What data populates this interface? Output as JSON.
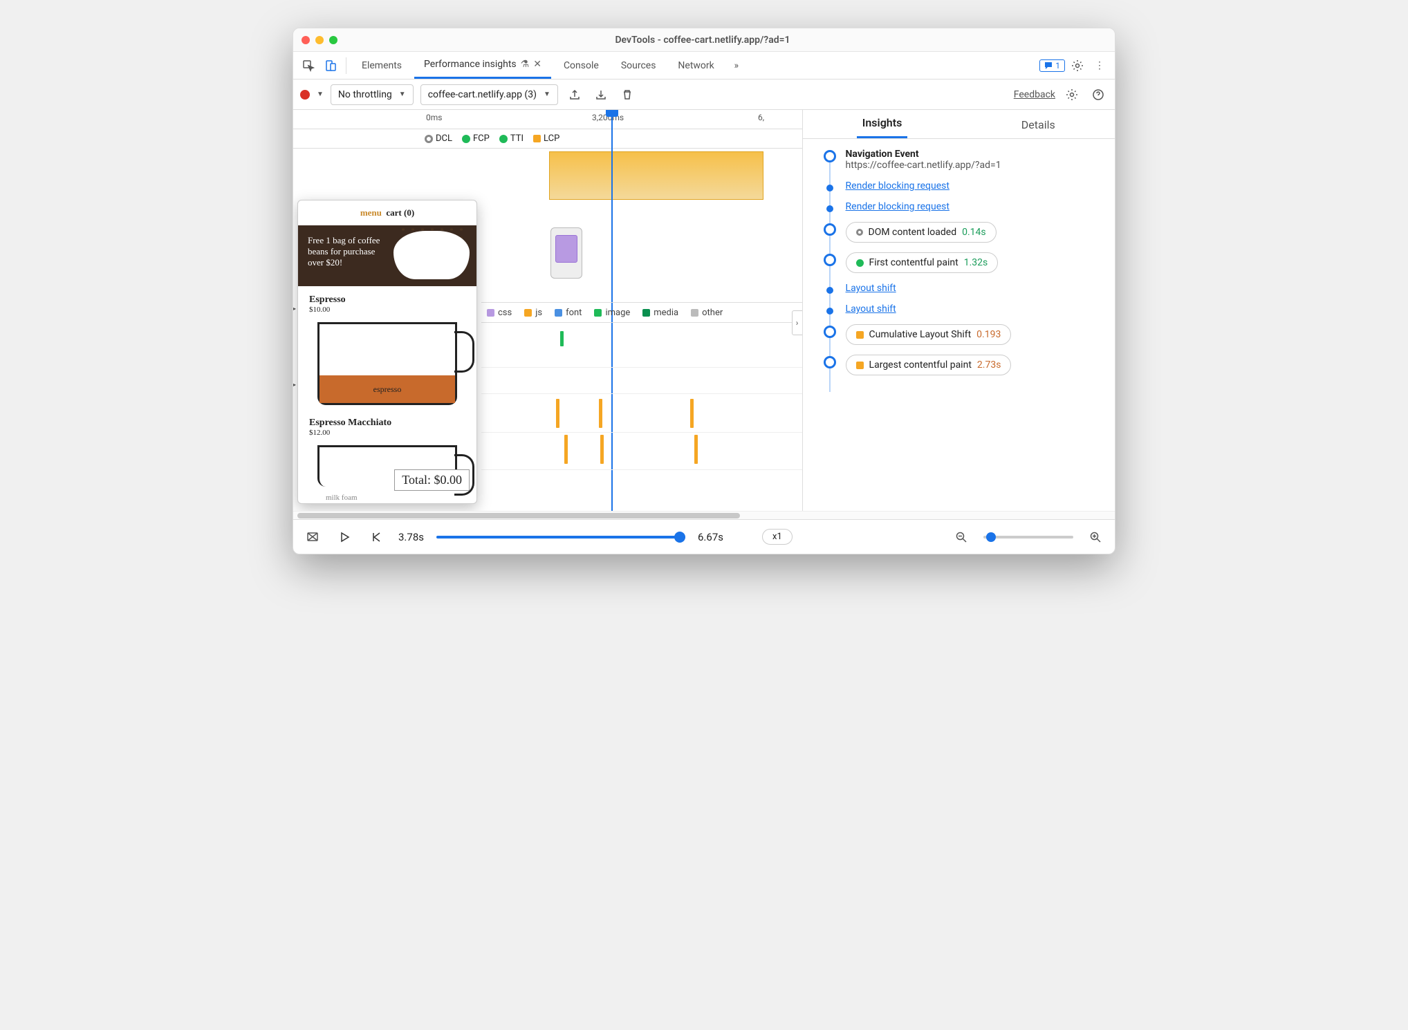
{
  "window": {
    "title": "DevTools - coffee-cart.netlify.app/?ad=1"
  },
  "tabs": {
    "items": [
      "Elements",
      "Performance insights",
      "Console",
      "Sources",
      "Network"
    ],
    "active": 1,
    "badge_count": "1"
  },
  "toolbar": {
    "throttle": "No throttling",
    "recording": "coffee-cart.netlify.app (3)",
    "feedback": "Feedback"
  },
  "timeline": {
    "axis": {
      "t0": "0ms",
      "t1": "3,200ms",
      "t2": "6,"
    },
    "markers": {
      "dcl": "DCL",
      "fcp": "FCP",
      "tti": "TTI",
      "lcp": "LCP"
    },
    "legend": {
      "css": "css",
      "js": "js",
      "font": "font",
      "image": "image",
      "media": "media",
      "other": "other"
    }
  },
  "preview": {
    "menu": "menu",
    "cart": "cart (0)",
    "banner": "Free 1 bag of coffee beans for purchase over $20!",
    "p1_name": "Espresso",
    "p1_price": "$10.00",
    "p1_fill": "espresso",
    "p2_name": "Espresso Macchiato",
    "p2_price": "$12.00",
    "p2_foam": "milk foam",
    "total": "Total: $0.00"
  },
  "side": {
    "tabs": {
      "insights": "Insights",
      "details": "Details"
    },
    "nav": {
      "title": "Navigation Event",
      "url": "https://coffee-cart.netlify.app/?ad=1"
    },
    "rbr": "Render blocking request",
    "ls": "Layout shift",
    "dcl": {
      "label": "DOM content loaded",
      "time": "0.14s"
    },
    "fcp": {
      "label": "First contentful paint",
      "time": "1.32s"
    },
    "cls": {
      "label": "Cumulative Layout Shift",
      "time": "0.193"
    },
    "lcp": {
      "label": "Largest contentful paint",
      "time": "2.73s"
    }
  },
  "footer": {
    "cur": "3.78s",
    "end": "6.67s",
    "zoom": "x1"
  }
}
